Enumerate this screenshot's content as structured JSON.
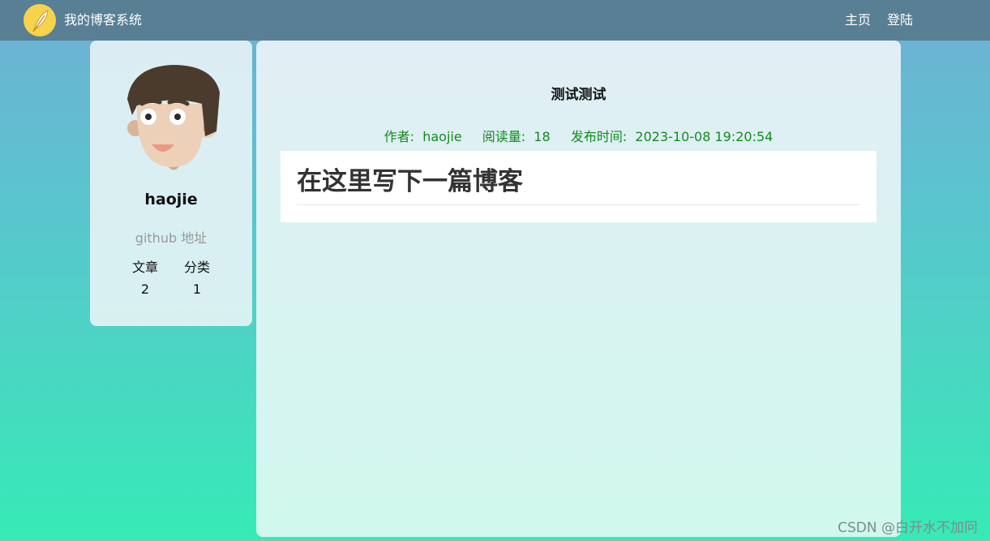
{
  "nav": {
    "site_title": "我的博客系统",
    "links": {
      "home": "主页",
      "login": "登陆"
    },
    "logo_icon": "feather-quill-icon"
  },
  "profile": {
    "avatar_icon": "cartoon-avatar-icon",
    "username": "haojie",
    "github_link": "github 地址",
    "stats": {
      "articles_label": "文章",
      "categories_label": "分类",
      "articles_count": "2",
      "categories_count": "1"
    }
  },
  "post": {
    "title": "测试测试",
    "meta": {
      "author_label": "作者:",
      "author": "haojie",
      "views_label": "阅读量:",
      "views": "18",
      "time_label": "发布时间:",
      "time": "2023-10-08 19:20:54"
    },
    "body_heading": "在这里写下一篇博客"
  },
  "watermark": "CSDN @白开水不加冋",
  "colors": {
    "nav_bg": "#587f94",
    "meta_text": "#148a1e",
    "logo_bg": "#f7d24d"
  }
}
